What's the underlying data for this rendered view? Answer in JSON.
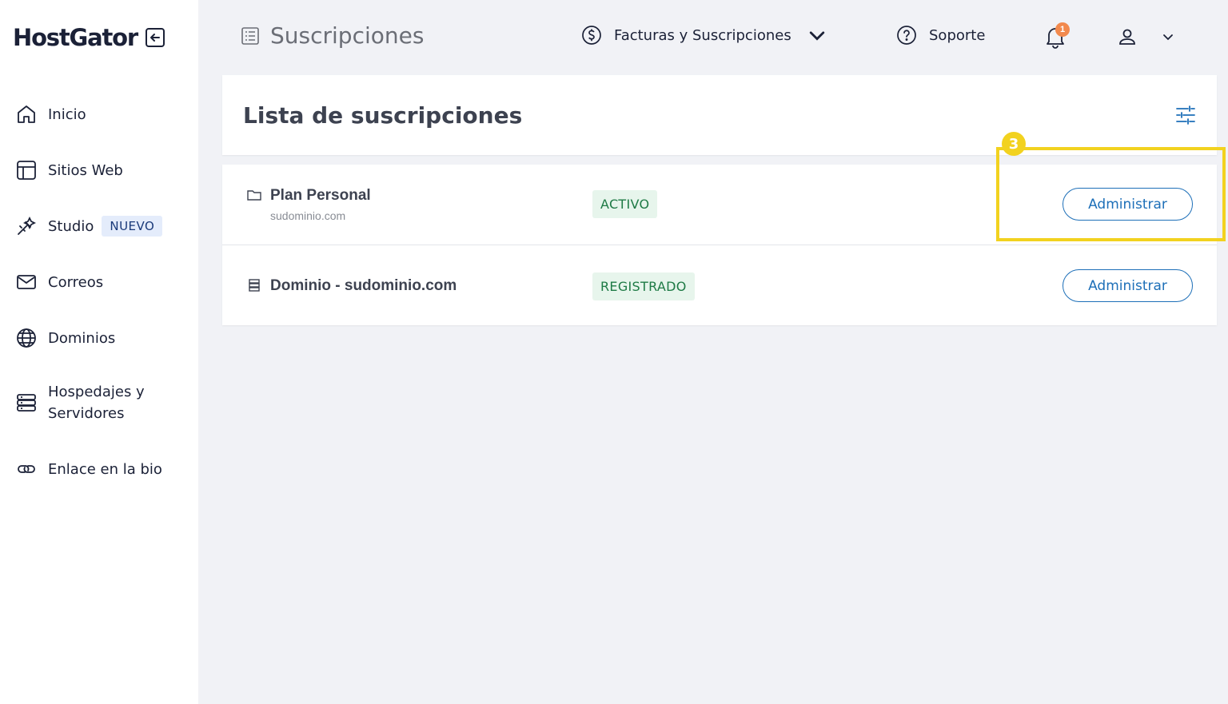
{
  "brand": {
    "name": "HostGator"
  },
  "sidebar": {
    "items": [
      {
        "label": "Inicio",
        "icon": "home-icon"
      },
      {
        "label": "Sitios Web",
        "icon": "layout-icon"
      },
      {
        "label": "Studio",
        "icon": "magic-tools-icon",
        "badge": "NUEVO"
      },
      {
        "label": "Correos",
        "icon": "mail-icon"
      },
      {
        "label": "Dominios",
        "icon": "globe-icon"
      },
      {
        "label": "Hospedajes y Servidores",
        "icon": "server-icon"
      },
      {
        "label": "Enlace en la bio",
        "icon": "link-icon"
      }
    ]
  },
  "header": {
    "title": "Suscripciones",
    "billing_label": "Facturas y Suscripciones",
    "support_label": "Soporte",
    "notification_count": "1"
  },
  "main": {
    "list_title": "Lista de suscripciones",
    "rows": [
      {
        "title": "Plan Personal",
        "subtitle": "sudominio.com",
        "status": "ACTIVO",
        "action": "Administrar",
        "icon": "folder-icon"
      },
      {
        "title": "Dominio - sudominio.com",
        "subtitle": "",
        "status": "REGISTRADO",
        "action": "Administrar",
        "icon": "domain-icon"
      }
    ]
  },
  "tutorial": {
    "step": "3"
  },
  "colors": {
    "accent": "#1d6fb8",
    "highlight": "#f2d21f",
    "status_green": "#1e7a45",
    "notification": "#f2894d"
  }
}
